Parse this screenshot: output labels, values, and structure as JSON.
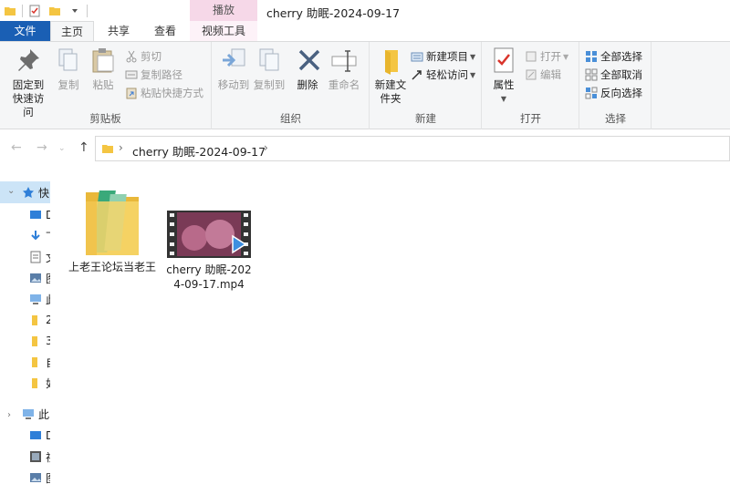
{
  "titlebar": {
    "contextual_tab": "播放",
    "title": "cherry 助眠-2024-09-17"
  },
  "tabs": {
    "file": "文件",
    "home": "主页",
    "share": "共享",
    "view": "查看",
    "video_tools": "视频工具"
  },
  "ribbon": {
    "clipboard": {
      "pin": "固定到快速访问",
      "copy": "复制",
      "paste": "粘贴",
      "cut": "剪切",
      "copy_path": "复制路径",
      "paste_shortcut": "粘贴快捷方式",
      "label": "剪贴板"
    },
    "organize": {
      "move_to": "移动到",
      "copy_to": "复制到",
      "delete": "删除",
      "rename": "重命名",
      "label": "组织"
    },
    "new": {
      "new_folder": "新建文件夹",
      "new_item": "新建项目",
      "easy_access": "轻松访问",
      "label": "新建"
    },
    "open": {
      "properties": "属性",
      "open": "打开",
      "edit": "编辑",
      "label": "打开"
    },
    "select": {
      "select_all": "全部选择",
      "select_none": "全部取消",
      "invert": "反向选择",
      "label": "选择"
    }
  },
  "address": {
    "path": "cherry 助眠-2024-09-17"
  },
  "leftpane": {
    "quick_access": "快",
    "items": [
      "D",
      "下",
      "文",
      "图",
      "此",
      "2",
      "3",
      "自",
      "如"
    ],
    "this_pc": "此",
    "pc_items": [
      "D",
      "视",
      "图"
    ]
  },
  "files": [
    {
      "name": "上老王论坛当老王",
      "type": "folder"
    },
    {
      "name": "cherry 助眠-2024-09-17.mp4",
      "type": "video"
    }
  ]
}
